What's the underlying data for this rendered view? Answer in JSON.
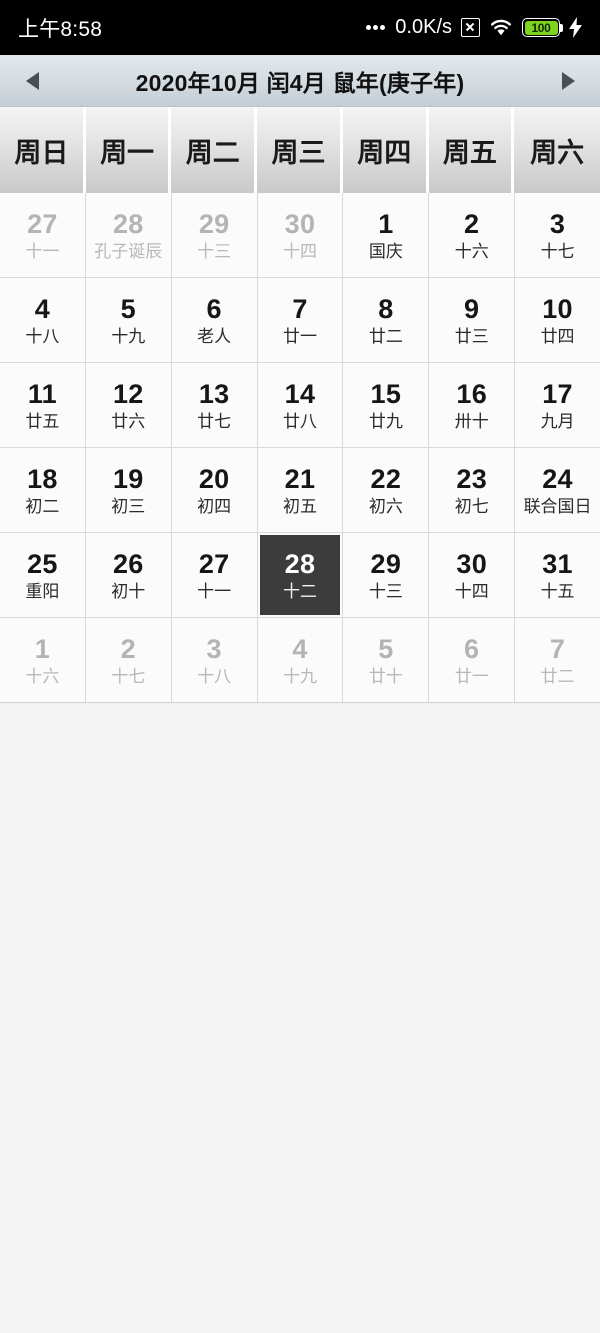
{
  "statusbar": {
    "clock": "上午8:58",
    "network_speed": "0.0K/s",
    "battery_level": "100",
    "icons": [
      "dots-icon",
      "xbox-icon",
      "wifi-icon",
      "battery-icon",
      "charging-bolt-icon"
    ]
  },
  "titlebar": {
    "prev_label": "◀",
    "next_label": "▶",
    "title": "2020年10月 闰4月 鼠年(庚子年)"
  },
  "weekdays": [
    "周日",
    "周一",
    "周二",
    "周三",
    "周四",
    "周五",
    "周六"
  ],
  "selected_date": "28",
  "colors": {
    "selected_bg": "#3c3c3c",
    "titlebar_top": "#e3e9ec",
    "titlebar_bottom": "#c5ced5",
    "battery_green": "#7ed321",
    "cell_bg": "#fbfbfb",
    "other_month_text": "#b4b4b4"
  },
  "days": [
    {
      "num": "27",
      "lunar": "十一",
      "other": true,
      "selected": false
    },
    {
      "num": "28",
      "lunar": "孔子诞辰",
      "other": true,
      "selected": false
    },
    {
      "num": "29",
      "lunar": "十三",
      "other": true,
      "selected": false
    },
    {
      "num": "30",
      "lunar": "十四",
      "other": true,
      "selected": false
    },
    {
      "num": "1",
      "lunar": "国庆",
      "other": false,
      "selected": false
    },
    {
      "num": "2",
      "lunar": "十六",
      "other": false,
      "selected": false
    },
    {
      "num": "3",
      "lunar": "十七",
      "other": false,
      "selected": false
    },
    {
      "num": "4",
      "lunar": "十八",
      "other": false,
      "selected": false
    },
    {
      "num": "5",
      "lunar": "十九",
      "other": false,
      "selected": false
    },
    {
      "num": "6",
      "lunar": "老人",
      "other": false,
      "selected": false
    },
    {
      "num": "7",
      "lunar": "廿一",
      "other": false,
      "selected": false
    },
    {
      "num": "8",
      "lunar": "廿二",
      "other": false,
      "selected": false
    },
    {
      "num": "9",
      "lunar": "廿三",
      "other": false,
      "selected": false
    },
    {
      "num": "10",
      "lunar": "廿四",
      "other": false,
      "selected": false
    },
    {
      "num": "11",
      "lunar": "廿五",
      "other": false,
      "selected": false
    },
    {
      "num": "12",
      "lunar": "廿六",
      "other": false,
      "selected": false
    },
    {
      "num": "13",
      "lunar": "廿七",
      "other": false,
      "selected": false
    },
    {
      "num": "14",
      "lunar": "廿八",
      "other": false,
      "selected": false
    },
    {
      "num": "15",
      "lunar": "廿九",
      "other": false,
      "selected": false
    },
    {
      "num": "16",
      "lunar": "卅十",
      "other": false,
      "selected": false
    },
    {
      "num": "17",
      "lunar": "九月",
      "other": false,
      "selected": false
    },
    {
      "num": "18",
      "lunar": "初二",
      "other": false,
      "selected": false
    },
    {
      "num": "19",
      "lunar": "初三",
      "other": false,
      "selected": false
    },
    {
      "num": "20",
      "lunar": "初四",
      "other": false,
      "selected": false
    },
    {
      "num": "21",
      "lunar": "初五",
      "other": false,
      "selected": false
    },
    {
      "num": "22",
      "lunar": "初六",
      "other": false,
      "selected": false
    },
    {
      "num": "23",
      "lunar": "初七",
      "other": false,
      "selected": false
    },
    {
      "num": "24",
      "lunar": "联合国日",
      "other": false,
      "selected": false
    },
    {
      "num": "25",
      "lunar": "重阳",
      "other": false,
      "selected": false
    },
    {
      "num": "26",
      "lunar": "初十",
      "other": false,
      "selected": false
    },
    {
      "num": "27",
      "lunar": "十一",
      "other": false,
      "selected": false
    },
    {
      "num": "28",
      "lunar": "十二",
      "other": false,
      "selected": true
    },
    {
      "num": "29",
      "lunar": "十三",
      "other": false,
      "selected": false
    },
    {
      "num": "30",
      "lunar": "十四",
      "other": false,
      "selected": false
    },
    {
      "num": "31",
      "lunar": "十五",
      "other": false,
      "selected": false
    },
    {
      "num": "1",
      "lunar": "十六",
      "other": true,
      "selected": false
    },
    {
      "num": "2",
      "lunar": "十七",
      "other": true,
      "selected": false
    },
    {
      "num": "3",
      "lunar": "十八",
      "other": true,
      "selected": false
    },
    {
      "num": "4",
      "lunar": "十九",
      "other": true,
      "selected": false
    },
    {
      "num": "5",
      "lunar": "廿十",
      "other": true,
      "selected": false
    },
    {
      "num": "6",
      "lunar": "廿一",
      "other": true,
      "selected": false
    },
    {
      "num": "7",
      "lunar": "廿二",
      "other": true,
      "selected": false
    }
  ]
}
